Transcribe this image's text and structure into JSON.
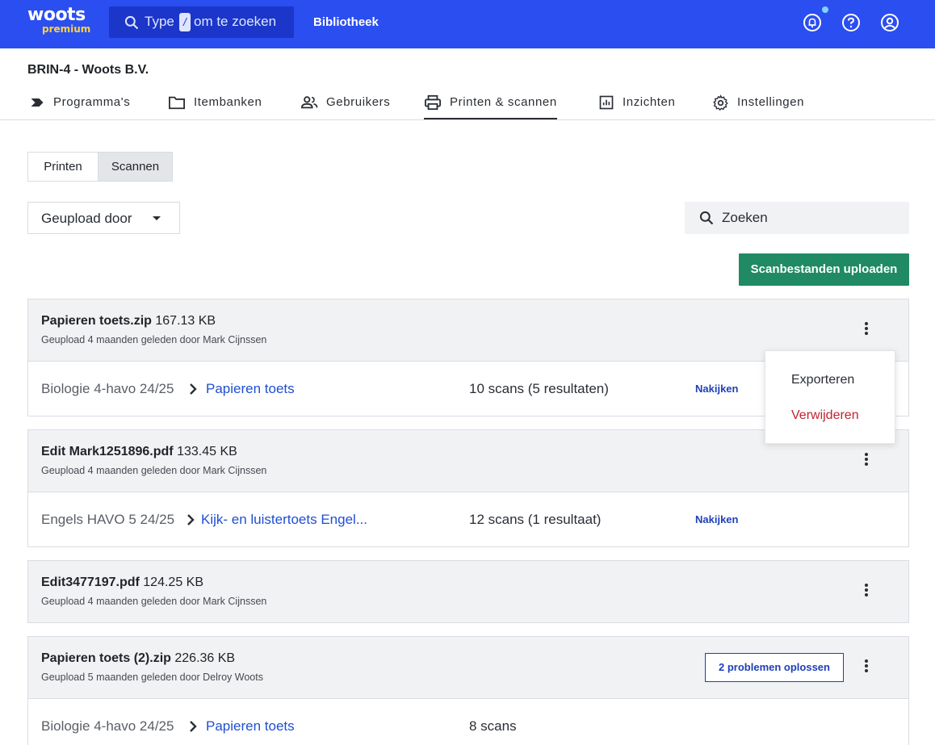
{
  "brand": {
    "name": "woots",
    "tier": "premium"
  },
  "search": {
    "prefix": "Type",
    "key": "/",
    "suffix": "om te zoeken"
  },
  "topnav": {
    "library": "Bibliotheek"
  },
  "org": {
    "title": "BRIN-4 - Woots B.V."
  },
  "tabs": [
    {
      "label": "Programma's",
      "icon": "tag-icon"
    },
    {
      "label": "Itembanken",
      "icon": "folder-icon"
    },
    {
      "label": "Gebruikers",
      "icon": "users-icon"
    },
    {
      "label": "Printen & scannen",
      "icon": "printer-icon",
      "active": true
    },
    {
      "label": "Inzichten",
      "icon": "chart-icon"
    },
    {
      "label": "Instellingen",
      "icon": "gear-icon"
    }
  ],
  "toggle": {
    "print": "Printen",
    "scan": "Scannen",
    "selected": "Scannen"
  },
  "filter": {
    "uploaded_by": "Geupload door"
  },
  "zoek": {
    "placeholder": "Zoeken"
  },
  "upload_button": "Scanbestanden uploaden",
  "uploads": [
    {
      "name": "Papieren toets.zip",
      "size": "167.13 KB",
      "meta": "Geupload 4 maanden geleden door Mark Cijnssen",
      "course": "Biologie 4-havo 24/25",
      "test": "Papieren toets",
      "scans": "10 scans (5 resultaten)",
      "action": "Nakijken"
    },
    {
      "name": "Edit Mark1251896.pdf",
      "size": "133.45 KB",
      "meta": "Geupload 4 maanden geleden door Mark Cijnssen",
      "course": "Engels HAVO 5 24/25",
      "test": "Kijk- en luistertoets Engel...",
      "scans": "12 scans (1 resultaat)",
      "action": "Nakijken"
    },
    {
      "name": "Edit3477197.pdf",
      "size": "124.25 KB",
      "meta": "Geupload 4 maanden geleden door Mark Cijnssen"
    },
    {
      "name": "Papieren toets (2).zip",
      "size": "226.36 KB",
      "meta": "Geupload 5 maanden geleden door Delroy Woots",
      "problems": "2 problemen oplossen",
      "course": "Biologie 4-havo 24/25",
      "test": "Papieren toets",
      "scans": "8 scans"
    }
  ],
  "menu": {
    "export": "Exporteren",
    "delete": "Verwijderen"
  },
  "colors": {
    "brand": "#2b4ef0",
    "primary_button": "#1f8a64",
    "danger": "#c4212c",
    "link": "#1f4fd1"
  }
}
